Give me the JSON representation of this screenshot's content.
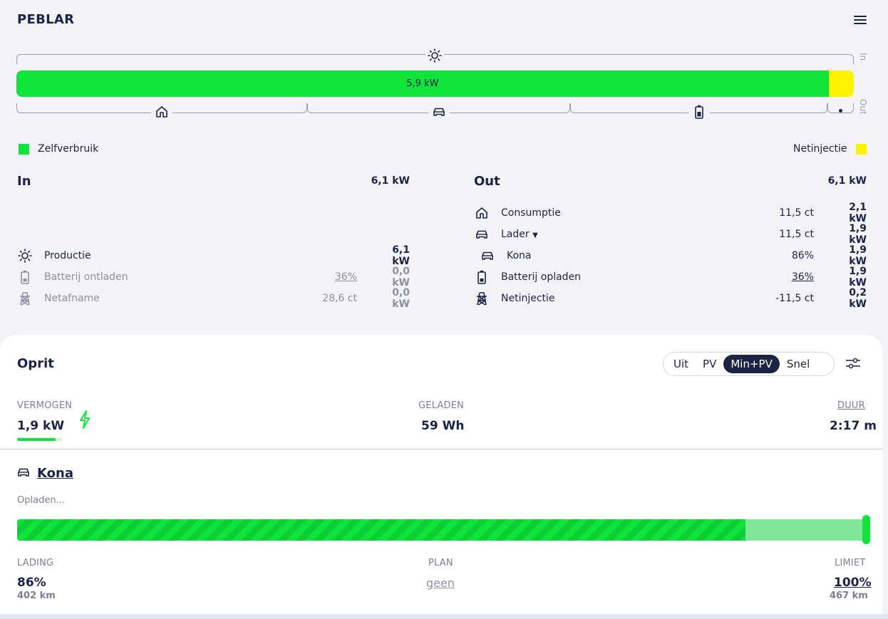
{
  "header": {
    "title": "PEBLAR",
    "menu_icon": "hamburger-icon"
  },
  "flow": {
    "bar_value": "5,9 kW",
    "self_consumption_fraction": 0.97,
    "side_in": "In",
    "side_out": "Out",
    "colors": {
      "self": "#0fe33c",
      "grid": "#fff200"
    }
  },
  "legend": {
    "self": "Zelfverbruik",
    "grid": "Netinjectie"
  },
  "in": {
    "title": "In",
    "total": "6,1 kW",
    "rows": [
      {
        "icon": "sun-icon",
        "label": "Productie",
        "mid": "",
        "value": "6,1 kW"
      },
      {
        "icon": "battery-icon",
        "label": "Batterij ontladen",
        "mid": "36%",
        "value": "0,0 kW"
      },
      {
        "icon": "grid-tower-icon",
        "label": "Netafname",
        "mid": "28,6 ct",
        "value": "0,0 kW"
      }
    ]
  },
  "out": {
    "title": "Out",
    "total": "6,1 kW",
    "rows": [
      {
        "icon": "home-icon",
        "label": "Consumptie",
        "mid": "11,5 ct",
        "value": "2,1 kW"
      },
      {
        "icon": "car-icon",
        "label": "Lader",
        "mid": "11,5 ct",
        "value": "1,9 kW"
      },
      {
        "icon": "car-icon",
        "label": "Kona",
        "mid": "86%",
        "value": "1,9 kW"
      },
      {
        "icon": "battery-icon",
        "label": "Batterij opladen",
        "mid": "36%",
        "value": "1,9 kW"
      },
      {
        "icon": "grid-tower-icon",
        "label": "Netinjectie",
        "mid": "-11,5 ct",
        "value": "0,2 kW"
      }
    ]
  },
  "loadpoint": {
    "title": "Oprit",
    "modes": [
      "Uit",
      "PV",
      "Min+PV",
      "Snel"
    ],
    "active_mode": "Min+PV",
    "power_label": "VERMOGEN",
    "power_value": "1,9 kW",
    "charged_label": "GELADEN",
    "charged_value": "59 Wh",
    "duration_label": "DUUR",
    "duration_value": "2:17 m"
  },
  "vehicle": {
    "name": "Kona",
    "status": "Opladen...",
    "soc_fraction": 0.86,
    "limit_fraction": 1.0,
    "soc_label": "LADING",
    "soc_value": "86%",
    "soc_range": "402 km",
    "plan_label": "PLAN",
    "plan_value": "geen",
    "limit_label": "LIMIET",
    "limit_value": "100%",
    "limit_range": "467 km"
  }
}
